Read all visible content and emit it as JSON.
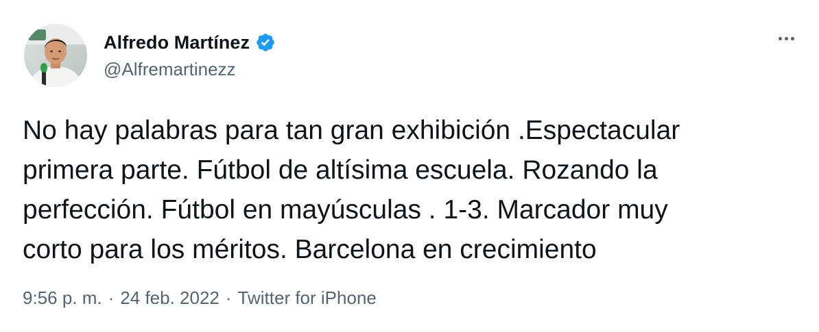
{
  "user": {
    "display_name": "Alfredo Martínez",
    "handle": "@Alfremartinezz",
    "verified": true
  },
  "tweet": {
    "lines": [
      "No hay palabras para tan gran exhibición .Espectacular",
      "primera parte. Fútbol de altísima escuela. Rozando la",
      "perfección. Fútbol en mayúsculas . 1-3. Marcador muy",
      "corto para los méritos. Barcelona en crecimiento"
    ]
  },
  "meta": {
    "time": "9:56 p. m.",
    "separator": "·",
    "date": "24 feb. 2022",
    "source": "Twitter for iPhone"
  },
  "icons": {
    "verified": "verified-badge-icon",
    "more": "more-options-icon"
  },
  "colors": {
    "text": "#0f1419",
    "secondary": "#536471",
    "verified": "#1d9bf0"
  }
}
